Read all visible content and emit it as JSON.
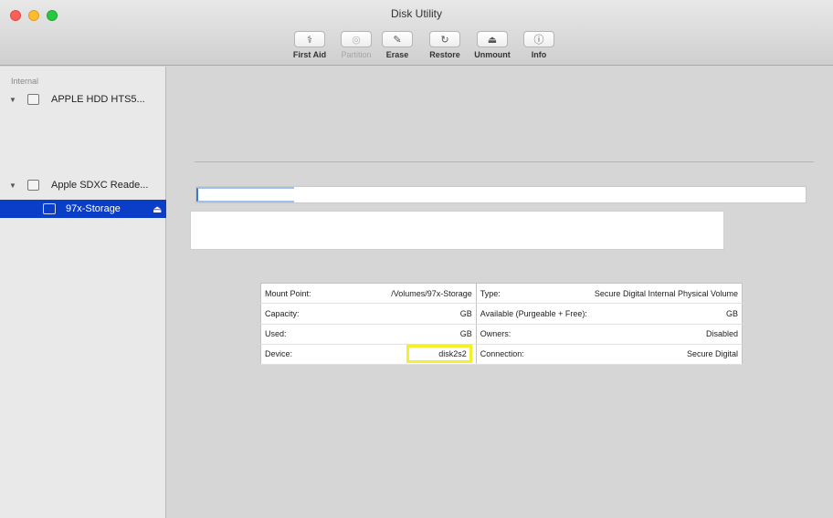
{
  "window": {
    "title": "Disk Utility"
  },
  "toolbar": {
    "buttons": [
      {
        "label": "First Aid",
        "icon": "stethoscope-icon",
        "glyph": "⚕",
        "enabled": true
      },
      {
        "label": "Partition",
        "icon": "partition-icon",
        "glyph": "◎",
        "enabled": false
      },
      {
        "label": "Erase",
        "icon": "erase-icon",
        "glyph": "✎",
        "enabled": true
      },
      {
        "label": "Restore",
        "icon": "restore-icon",
        "glyph": "↻",
        "enabled": true
      },
      {
        "label": "Unmount",
        "icon": "unmount-icon",
        "glyph": "⏏",
        "enabled": true
      },
      {
        "label": "Info",
        "icon": "info-icon",
        "glyph": "ⓘ",
        "enabled": true
      }
    ]
  },
  "sidebar": {
    "section_label": "Internal",
    "items": [
      {
        "label": "APPLE HDD HTS5...",
        "expanded": true
      },
      {
        "label": "Apple SDXC Reade...",
        "expanded": true
      },
      {
        "label": "97x-Storage",
        "selected": true
      }
    ]
  },
  "info": {
    "mount_point_label": "Mount Point:",
    "mount_point_value": "/Volumes/97x-Storage",
    "type_label": "Type:",
    "type_value": "Secure Digital Internal Physical Volume",
    "capacity_label": "Capacity:",
    "capacity_value": "GB",
    "available_label": "Available (Purgeable + Free):",
    "available_value": "GB",
    "used_label": "Used:",
    "used_value": "GB",
    "owners_label": "Owners:",
    "owners_value": "Disabled",
    "device_label": "Device:",
    "device_value": "disk2s2",
    "connection_label": "Connection:",
    "connection_value": "Secure Digital"
  },
  "colors": {
    "selection": "#0a3dc8",
    "highlight": "#f5f02a"
  }
}
